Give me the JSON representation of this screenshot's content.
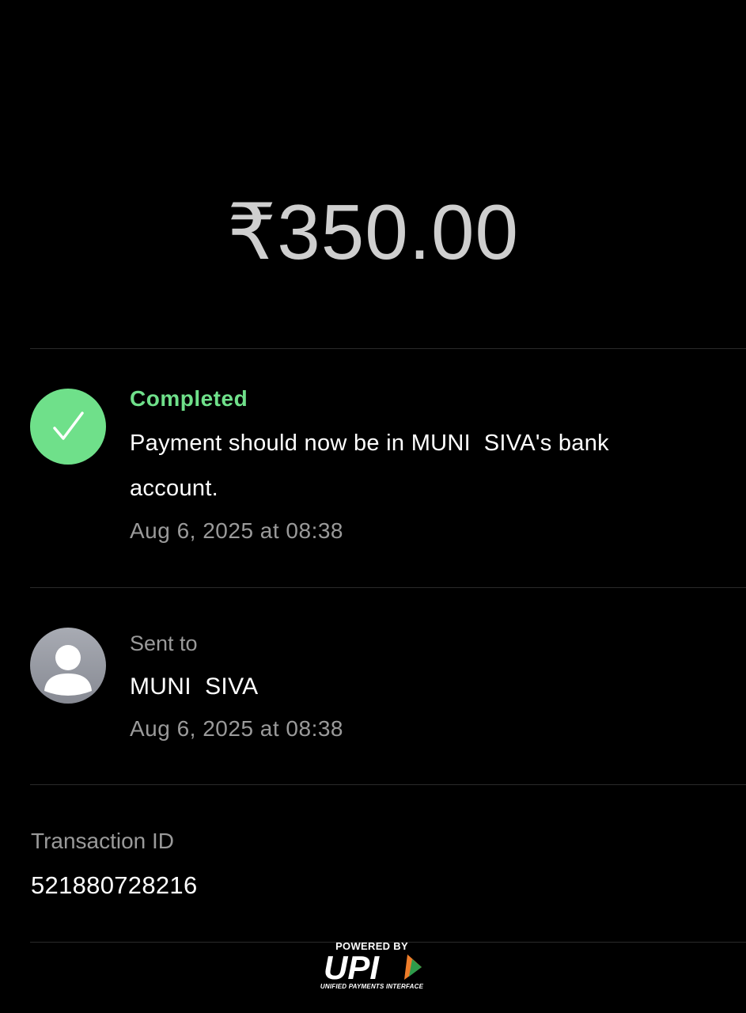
{
  "payment": {
    "amount": "₹350.00"
  },
  "status": {
    "label": "Completed",
    "message": "Payment should now be in MUNI  SIVA's bank\naccount.",
    "timestamp": "Aug 6, 2025 at 08:38",
    "icon": "check-icon",
    "color": "#6fe08a"
  },
  "recipient": {
    "label": "Sent to",
    "name": "MUNI  SIVA",
    "timestamp": "Aug 6, 2025 at 08:38",
    "icon": "person-avatar-icon"
  },
  "transaction": {
    "label": "Transaction ID",
    "id": "521880728216"
  },
  "footer": {
    "powered_by": "POWERED BY",
    "logo_text": "UPI",
    "tagline": "UNIFIED PAYMENTS INTERFACE"
  }
}
